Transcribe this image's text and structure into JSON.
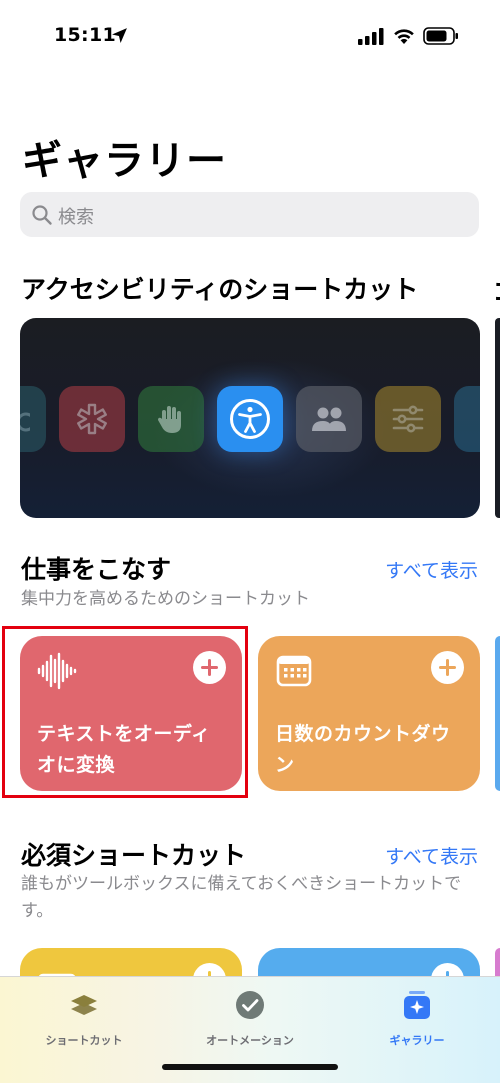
{
  "status_bar": {
    "time": "15:11"
  },
  "header": {
    "title": "ギャラリー"
  },
  "search": {
    "placeholder": "検索"
  },
  "accessibility": {
    "title": "アクセシビリティのショートカット",
    "next_title_peek": "ゴ"
  },
  "get_things_done": {
    "title": "仕事をこなす",
    "see_all": "すべて表示",
    "subtitle": "集中力を高めるためのショートカット",
    "cards": [
      {
        "title": "テキストをオーディオに変換",
        "color": "#e0676e",
        "icon": "waveform-icon"
      },
      {
        "title": "日数のカウントダウン",
        "color": "#eca65a",
        "icon": "calendar-icon"
      }
    ]
  },
  "essentials": {
    "title": "必須ショートカット",
    "see_all": "すべて表示",
    "subtitle": "誰もがツールボックスに備えておくべきショートカットです。",
    "cards": [
      {
        "color": "#efc73e",
        "icon": "keyboard-icon"
      },
      {
        "color": "#55acee",
        "icon": "list-icon"
      }
    ]
  },
  "tab_bar": {
    "tabs": [
      {
        "label": "ショートカット",
        "icon": "layers-icon",
        "active": false
      },
      {
        "label": "オートメーション",
        "icon": "checkmark-clock-icon",
        "active": false
      },
      {
        "label": "ギャラリー",
        "icon": "gallery-sparkle-icon",
        "active": true
      }
    ]
  }
}
